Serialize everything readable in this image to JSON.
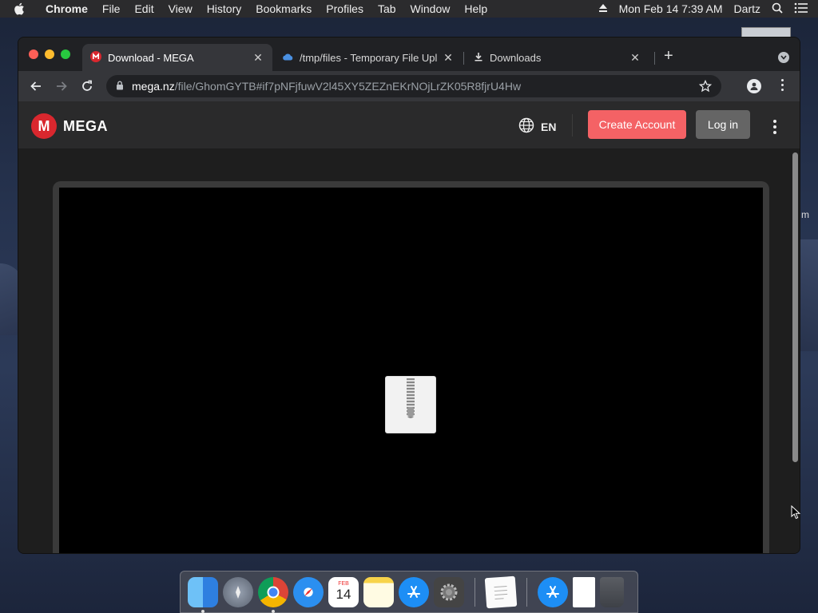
{
  "menubar": {
    "app": "Chrome",
    "items": [
      "File",
      "Edit",
      "View",
      "History",
      "Bookmarks",
      "Profiles",
      "Tab",
      "Window",
      "Help"
    ],
    "clock": "Mon Feb 14  7:39 AM",
    "user": "Dartz"
  },
  "desktop": {
    "peek_text": "m"
  },
  "tabs": [
    {
      "title": "Download - MEGA",
      "active": true
    },
    {
      "title": "/tmp/files - Temporary File Upl",
      "active": false
    },
    {
      "title": "Downloads",
      "active": false
    }
  ],
  "omnibox": {
    "host": "mega.nz",
    "path": "/file/GhomGYTB#if7pNFjfuwV2l45XY5ZEZnEKrNOjLrZK05R8fjrU4Hw"
  },
  "mega": {
    "logo_letter": "M",
    "brand": "MEGA",
    "language": "EN",
    "create_account": "Create Account",
    "login": "Log in"
  },
  "dock": {
    "calendar_month": "FEB",
    "calendar_day": "14",
    "items": [
      "finder-icon",
      "launchpad-icon",
      "chrome-icon",
      "safari-icon",
      "calendar-icon",
      "notes-icon",
      "app-store-icon",
      "system-preferences-icon",
      "textedit-icon",
      "app-store-icon",
      "document-icon",
      "trash-icon"
    ]
  },
  "colors": {
    "mega_red": "#d9272e",
    "create_button": "#f46265",
    "login_button": "#656565"
  }
}
